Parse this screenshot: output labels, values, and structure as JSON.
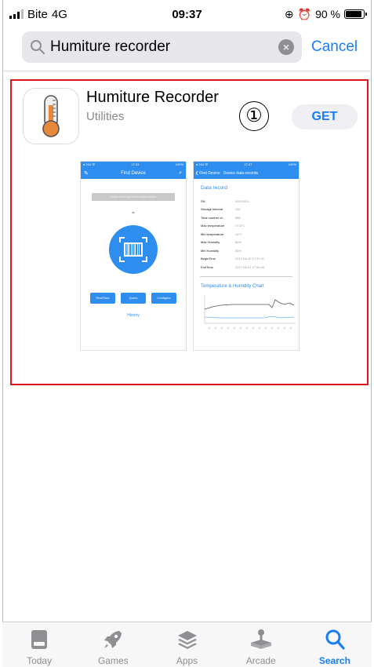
{
  "status_bar": {
    "carrier": "Bite",
    "network": "4G",
    "time": "09:37",
    "battery": "90 %",
    "battery_level": 0.9
  },
  "search": {
    "query": "Humiture recorder",
    "cancel_label": "Cancel"
  },
  "result": {
    "app_name": "Humiture Recorder",
    "category": "Utilities",
    "annotation": "①",
    "get_label": "GET",
    "screenshot1": {
      "status_left": "● 234 ☰",
      "status_time": "17:03",
      "status_right": "100%",
      "title": "Find Device",
      "placeholder": "Please enter the device serial number",
      "or": "or",
      "buttons": [
        "RealTime",
        "Query",
        "Configure"
      ],
      "history": "History"
    },
    "screenshot2": {
      "status_left": "● 234 ☰",
      "status_time": "17:07",
      "status_right": "100%",
      "back": "Find Device",
      "title": "Device data records",
      "section": "Data record",
      "rows": [
        {
          "k": "SN",
          "v": "40210001"
        },
        {
          "k": "Storage interval",
          "v": "150"
        },
        {
          "k": "Total number of...",
          "v": "586"
        },
        {
          "k": "Max temperature",
          "v": "27.8°C"
        },
        {
          "k": "Min temperature",
          "v": "16°C"
        },
        {
          "k": "Max Humidity",
          "v": "60%"
        },
        {
          "k": "Min Humidity",
          "v": "56%"
        },
        {
          "k": "BeginTime",
          "v": "2017-06-20 17:37:41"
        },
        {
          "k": "EndTime",
          "v": "2017-06-21 17:56:28"
        }
      ],
      "chart_title": "Temperature & Humidity Chart"
    }
  },
  "tabbar": {
    "tabs": [
      {
        "label": "Today",
        "icon": "today-icon"
      },
      {
        "label": "Games",
        "icon": "rocket-icon"
      },
      {
        "label": "Apps",
        "icon": "layers-icon"
      },
      {
        "label": "Arcade",
        "icon": "joystick-icon"
      },
      {
        "label": "Search",
        "icon": "search-icon"
      }
    ],
    "active": "Search",
    "inactive_color": "#8e8e93",
    "active_color": "#1a7cf5"
  },
  "colors": {
    "accent": "#1a7cf5",
    "highlight_border": "#e8121e",
    "screenshot_blue": "#2e8ef0"
  }
}
